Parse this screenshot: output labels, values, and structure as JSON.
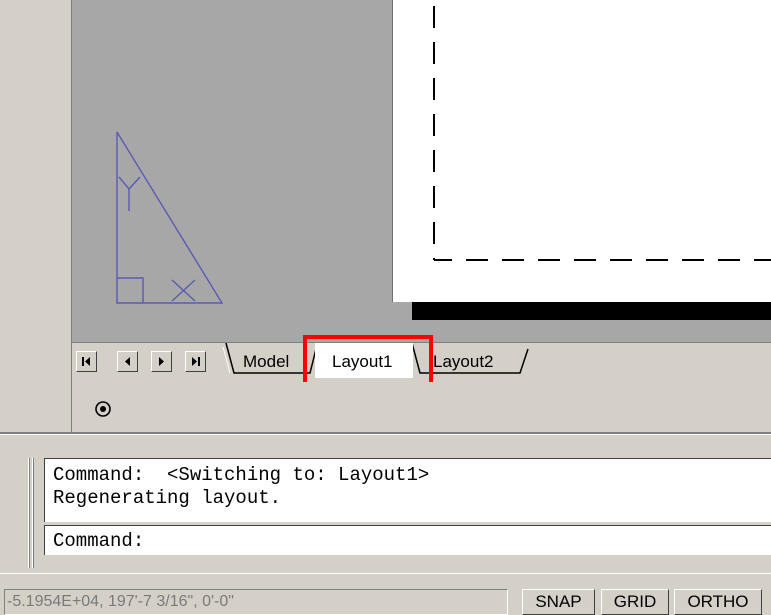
{
  "tabs": {
    "model": "Model",
    "layout1": "Layout1",
    "layout2": "Layout2"
  },
  "command_line": {
    "history": [
      "Command:  <Switching to: Layout1>",
      "Regenerating layout."
    ],
    "prompt": "Command:"
  },
  "status_bar": {
    "coordinates": "-5.1954E+04, 197'-7 3/16\", 0'-0\"",
    "snap": "SNAP",
    "grid": "GRID",
    "ortho": "ORTHO"
  },
  "icons": {
    "ucs": "ucs-triangle-icon",
    "nav_first": "nav-first-icon",
    "nav_prev": "nav-prev-icon",
    "nav_next": "nav-next-icon",
    "nav_last": "nav-last-icon",
    "viewport": "viewport-icon"
  },
  "colors": {
    "drawing_bg": "#a7a7a7",
    "paper": "#ffffff",
    "ucs": "#5a5ab4",
    "highlight": "#ff0000"
  }
}
